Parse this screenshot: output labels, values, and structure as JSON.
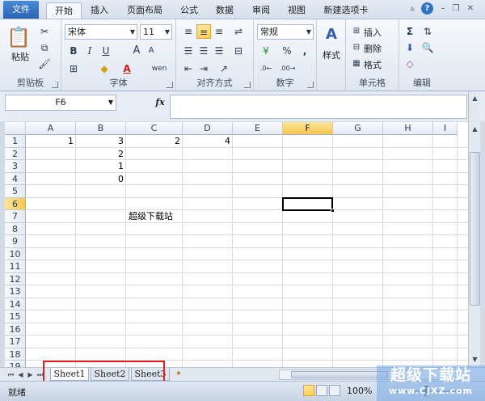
{
  "tabs": {
    "file": "文件",
    "items": [
      "开始",
      "插入",
      "页面布局",
      "公式",
      "数据",
      "审阅",
      "视图",
      "新建选项卡"
    ],
    "active": "开始"
  },
  "ribbon": {
    "clipboard": {
      "label": "剪贴板",
      "paste": "粘贴"
    },
    "font": {
      "label": "字体",
      "name": "宋体",
      "size": "11",
      "bold": "B",
      "italic": "I",
      "underline": "U",
      "grow": "A",
      "shrink": "A",
      "color": "A",
      "phonetic": "wen"
    },
    "alignment": {
      "label": "对齐方式"
    },
    "number": {
      "label": "数字",
      "format": "常规",
      "percent": "%",
      "comma": ","
    },
    "styles": {
      "label": "样式"
    },
    "cells": {
      "label": "单元格",
      "insert": "插入",
      "delete": "删除",
      "format": "格式"
    },
    "editing": {
      "label": "编辑",
      "sum": "Σ"
    }
  },
  "formula_bar": {
    "name_box": "F6",
    "fx": "fx",
    "content": ""
  },
  "columns": [
    "A",
    "B",
    "C",
    "D",
    "E",
    "F",
    "G",
    "H",
    "I"
  ],
  "rows": [
    "1",
    "2",
    "3",
    "4",
    "5",
    "6",
    "7",
    "8",
    "9",
    "10",
    "11",
    "12",
    "13",
    "14",
    "15",
    "16",
    "17",
    "18",
    "19"
  ],
  "active_cell": {
    "column": "F",
    "row": "6"
  },
  "cells": [
    {
      "ref": "A1",
      "value": "1"
    },
    {
      "ref": "B1",
      "value": "3"
    },
    {
      "ref": "C1",
      "value": "2"
    },
    {
      "ref": "D1",
      "value": "4"
    },
    {
      "ref": "B2",
      "value": "2"
    },
    {
      "ref": "B3",
      "value": "1"
    },
    {
      "ref": "B4",
      "value": "0"
    },
    {
      "ref": "C7",
      "value": "超级下载站"
    }
  ],
  "sheets": [
    "Sheet1",
    "Sheet2",
    "Sheet3"
  ],
  "active_sheet": "Sheet1",
  "status": {
    "ready": "就绪",
    "zoom": "100%"
  },
  "watermark": {
    "line1": "超级下载站",
    "line2": "www.CJXZ.com"
  }
}
